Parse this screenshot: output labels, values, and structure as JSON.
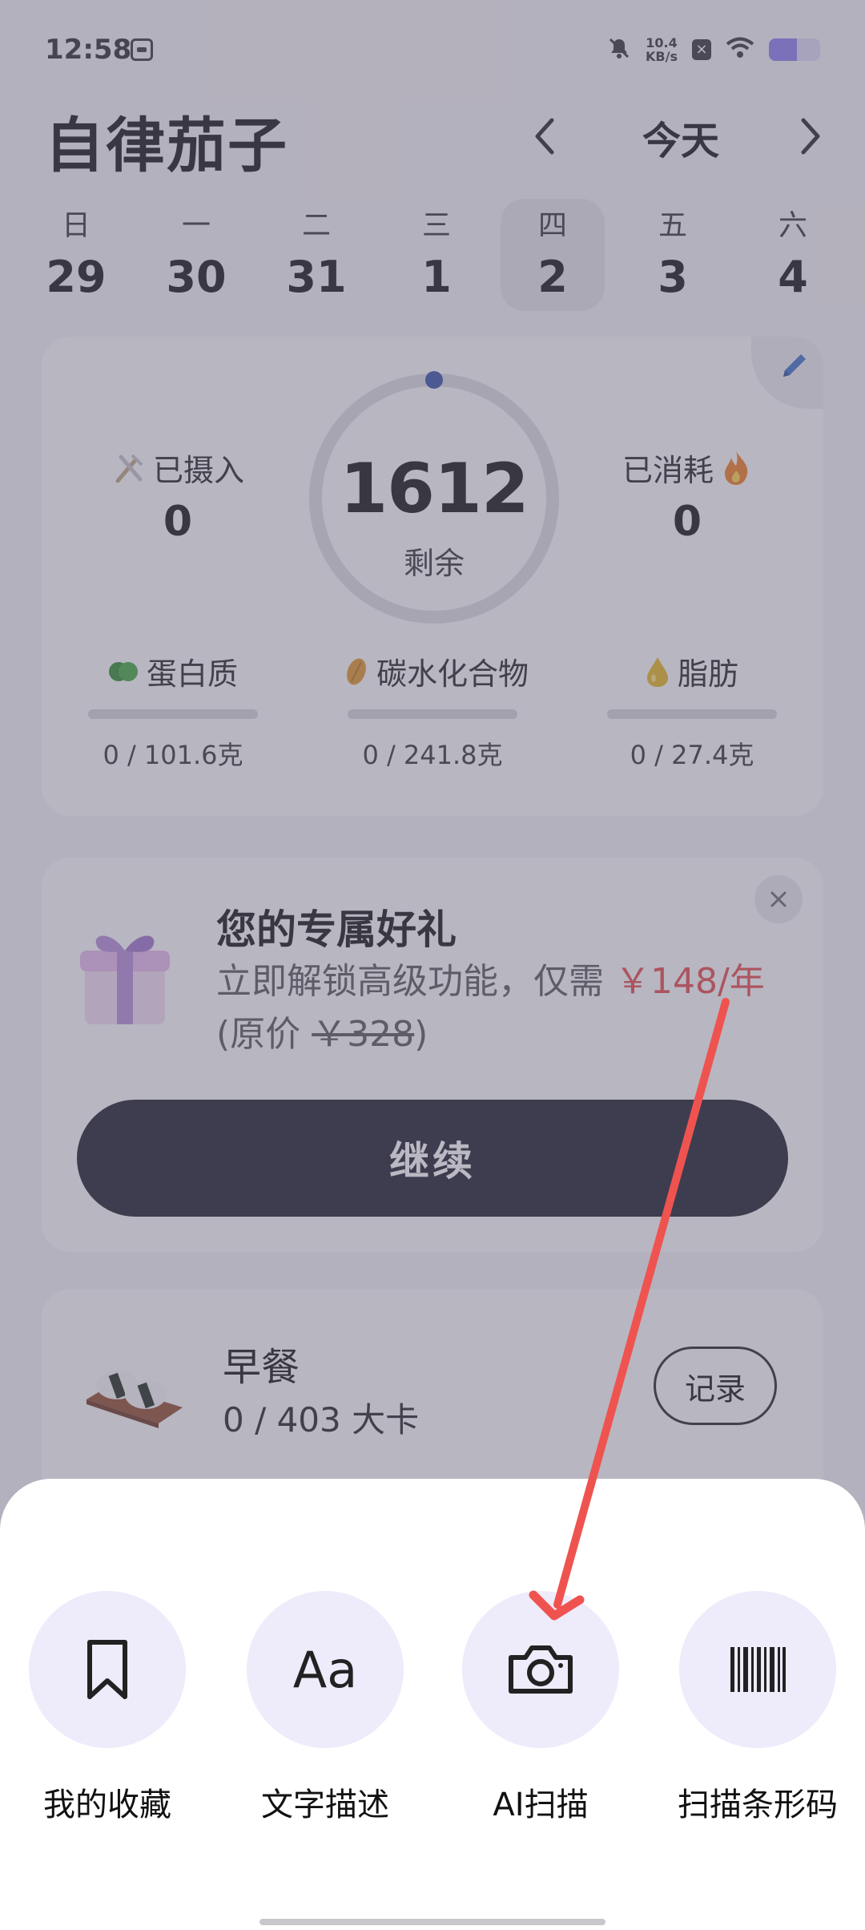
{
  "status_bar": {
    "time": "12:58",
    "net_speed_value": "10.4",
    "net_speed_unit": "KB/s",
    "battery_level_fraction": 0.55,
    "icons": [
      "calendar-icon",
      "mute-icon",
      "x-box-icon",
      "wifi-icon",
      "battery-icon"
    ]
  },
  "header": {
    "app_title": "自律茄子",
    "date_label": "今天"
  },
  "week": {
    "days": [
      {
        "name": "日",
        "num": "29"
      },
      {
        "name": "一",
        "num": "30"
      },
      {
        "name": "二",
        "num": "31"
      },
      {
        "name": "三",
        "num": "1"
      },
      {
        "name": "四",
        "num": "2"
      },
      {
        "name": "五",
        "num": "3"
      },
      {
        "name": "六",
        "num": "4"
      }
    ],
    "selected_index": 4
  },
  "summary": {
    "intake_label": "已摄入",
    "intake_value": "0",
    "remaining_value": "1612",
    "remaining_label": "剩余",
    "burned_label": "已消耗",
    "burned_value": "0",
    "ring_progress_fraction": 0,
    "macros": [
      {
        "name": "蛋白质",
        "value": "0 / 101.6克",
        "progress_fraction": 0,
        "icon": "protein-icon"
      },
      {
        "name": "碳水化合物",
        "value": "0 / 241.8克",
        "progress_fraction": 0,
        "icon": "carb-icon"
      },
      {
        "name": "脂肪",
        "value": "0 / 27.4克",
        "progress_fraction": 0,
        "icon": "fat-icon"
      }
    ]
  },
  "promo": {
    "title": "您的专属好礼",
    "desc_prefix": "立即解锁高级功能，仅需 ",
    "price": "￥148/年",
    "paren_open": "(原价 ",
    "original_price": "￥328",
    "paren_close": ")",
    "continue_label": "继续"
  },
  "meal": {
    "title": "早餐",
    "subtitle": "0 / 403 大卡",
    "record_label": "记录"
  },
  "sheet": {
    "actions": [
      {
        "label": "我的收藏",
        "icon": "bookmark-icon"
      },
      {
        "label": "文字描述",
        "icon": "text-icon",
        "glyph": "Aa"
      },
      {
        "label": "AI扫描",
        "icon": "camera-icon"
      },
      {
        "label": "扫描条形码",
        "icon": "barcode-icon"
      }
    ]
  },
  "colors": {
    "accent": "#8a7cf0",
    "price_red": "#e34848",
    "annotation_arrow": "#ef5350",
    "button_dark": "#1a1d2b"
  }
}
